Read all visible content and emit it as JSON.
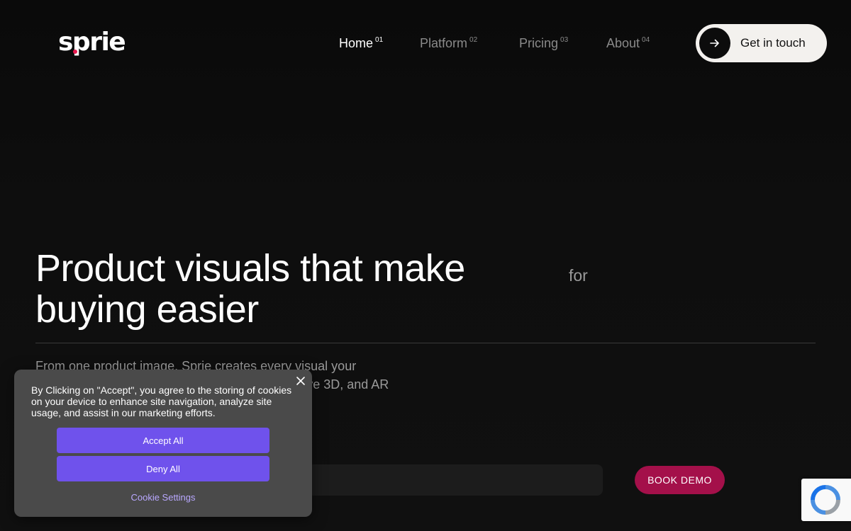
{
  "header": {
    "logo_text": "sprie",
    "nav": [
      {
        "label": "Home",
        "num": "01",
        "active": true
      },
      {
        "label": "Platform",
        "num": "02",
        "active": false
      },
      {
        "label": "Pricing",
        "num": "03",
        "active": false
      },
      {
        "label": "About",
        "num": "04",
        "active": false
      }
    ],
    "cta_label": "Get in touch"
  },
  "hero": {
    "title_line1": "Product visuals that make",
    "title_line2": "buying easier",
    "for_text": "for",
    "description": "From one product image, Sprie creates every visual your brand needs — lifestyle photos, videos, interactive 3D, and AR — ready for eCommerce, marketing, and the",
    "email_placeholder": "",
    "book_demo_label": "BOOK DEMO"
  },
  "cookie_banner": {
    "text": "By Clicking on \"Accept\", you agree to the storing of cookies on your device to enhance site navigation, analyze site usage, and assist in our marketing efforts.",
    "accept_label": "Accept All",
    "deny_label": "Deny All",
    "settings_label": "Cookie Settings"
  },
  "colors": {
    "background": "#0c0c0c",
    "accent_pink": "#e8194f",
    "demo_button": "#a4104a",
    "cookie_button": "#6f52ec",
    "cta_bg": "#f3f1ee"
  },
  "icons": [
    "arrow-right-icon",
    "close-icon",
    "recaptcha-icon"
  ]
}
